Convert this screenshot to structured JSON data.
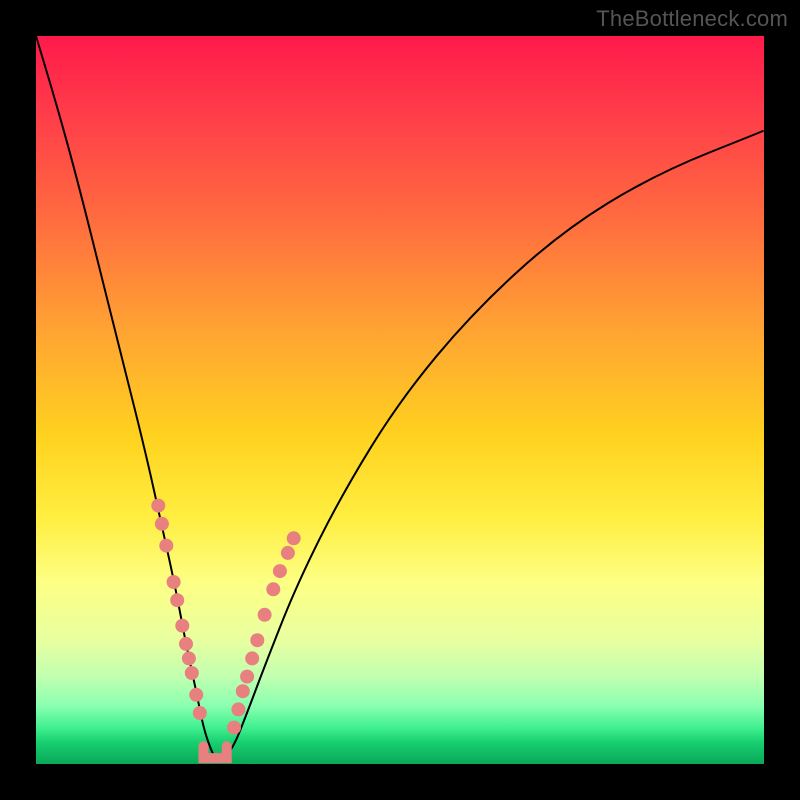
{
  "watermark": "TheBottleneck.com",
  "colors": {
    "dot": "#e88080",
    "curve": "#000000",
    "gradient_top": "#ff1a4b",
    "gradient_bottom": "#0aa858"
  },
  "chart_data": {
    "type": "line",
    "title": "",
    "xlabel": "",
    "ylabel": "",
    "xlim": [
      0,
      100
    ],
    "ylim": [
      0,
      100
    ],
    "grid": false,
    "legend": false,
    "note": "Axes unlabeled in source image; values are pixel-normalized 0–100. Curve represents bottleneck % vs component balance; valley is optimal match.",
    "series": [
      {
        "name": "bottleneck-curve",
        "x": [
          0,
          3,
          6,
          9,
          12,
          15,
          17,
          19,
          20.5,
          22,
          23,
          24,
          25,
          27,
          29,
          32,
          36,
          42,
          50,
          60,
          72,
          85,
          100
        ],
        "y": [
          100,
          90,
          79,
          67,
          55,
          43,
          34,
          25,
          17,
          10,
          5,
          2,
          0,
          2,
          7,
          15,
          25,
          37,
          50,
          62,
          73,
          81,
          87
        ]
      }
    ],
    "markers_left": [
      {
        "x": 16.8,
        "y": 35.5
      },
      {
        "x": 17.3,
        "y": 33.0
      },
      {
        "x": 17.9,
        "y": 30.0
      },
      {
        "x": 18.9,
        "y": 25.0
      },
      {
        "x": 19.4,
        "y": 22.5
      },
      {
        "x": 20.1,
        "y": 19.0
      },
      {
        "x": 20.6,
        "y": 16.5
      },
      {
        "x": 21.0,
        "y": 14.5
      },
      {
        "x": 21.4,
        "y": 12.5
      },
      {
        "x": 22.0,
        "y": 9.5
      },
      {
        "x": 22.5,
        "y": 7.0
      }
    ],
    "markers_right": [
      {
        "x": 27.2,
        "y": 5.0
      },
      {
        "x": 27.8,
        "y": 7.5
      },
      {
        "x": 28.4,
        "y": 10.0
      },
      {
        "x": 29.0,
        "y": 12.0
      },
      {
        "x": 29.7,
        "y": 14.5
      },
      {
        "x": 30.4,
        "y": 17.0
      },
      {
        "x": 31.4,
        "y": 20.5
      },
      {
        "x": 32.6,
        "y": 24.0
      },
      {
        "x": 33.5,
        "y": 26.5
      },
      {
        "x": 34.6,
        "y": 29.0
      },
      {
        "x": 35.4,
        "y": 31.0
      }
    ],
    "bracket": {
      "x_start": 23.0,
      "x_end": 26.2,
      "y": 0.8
    }
  }
}
